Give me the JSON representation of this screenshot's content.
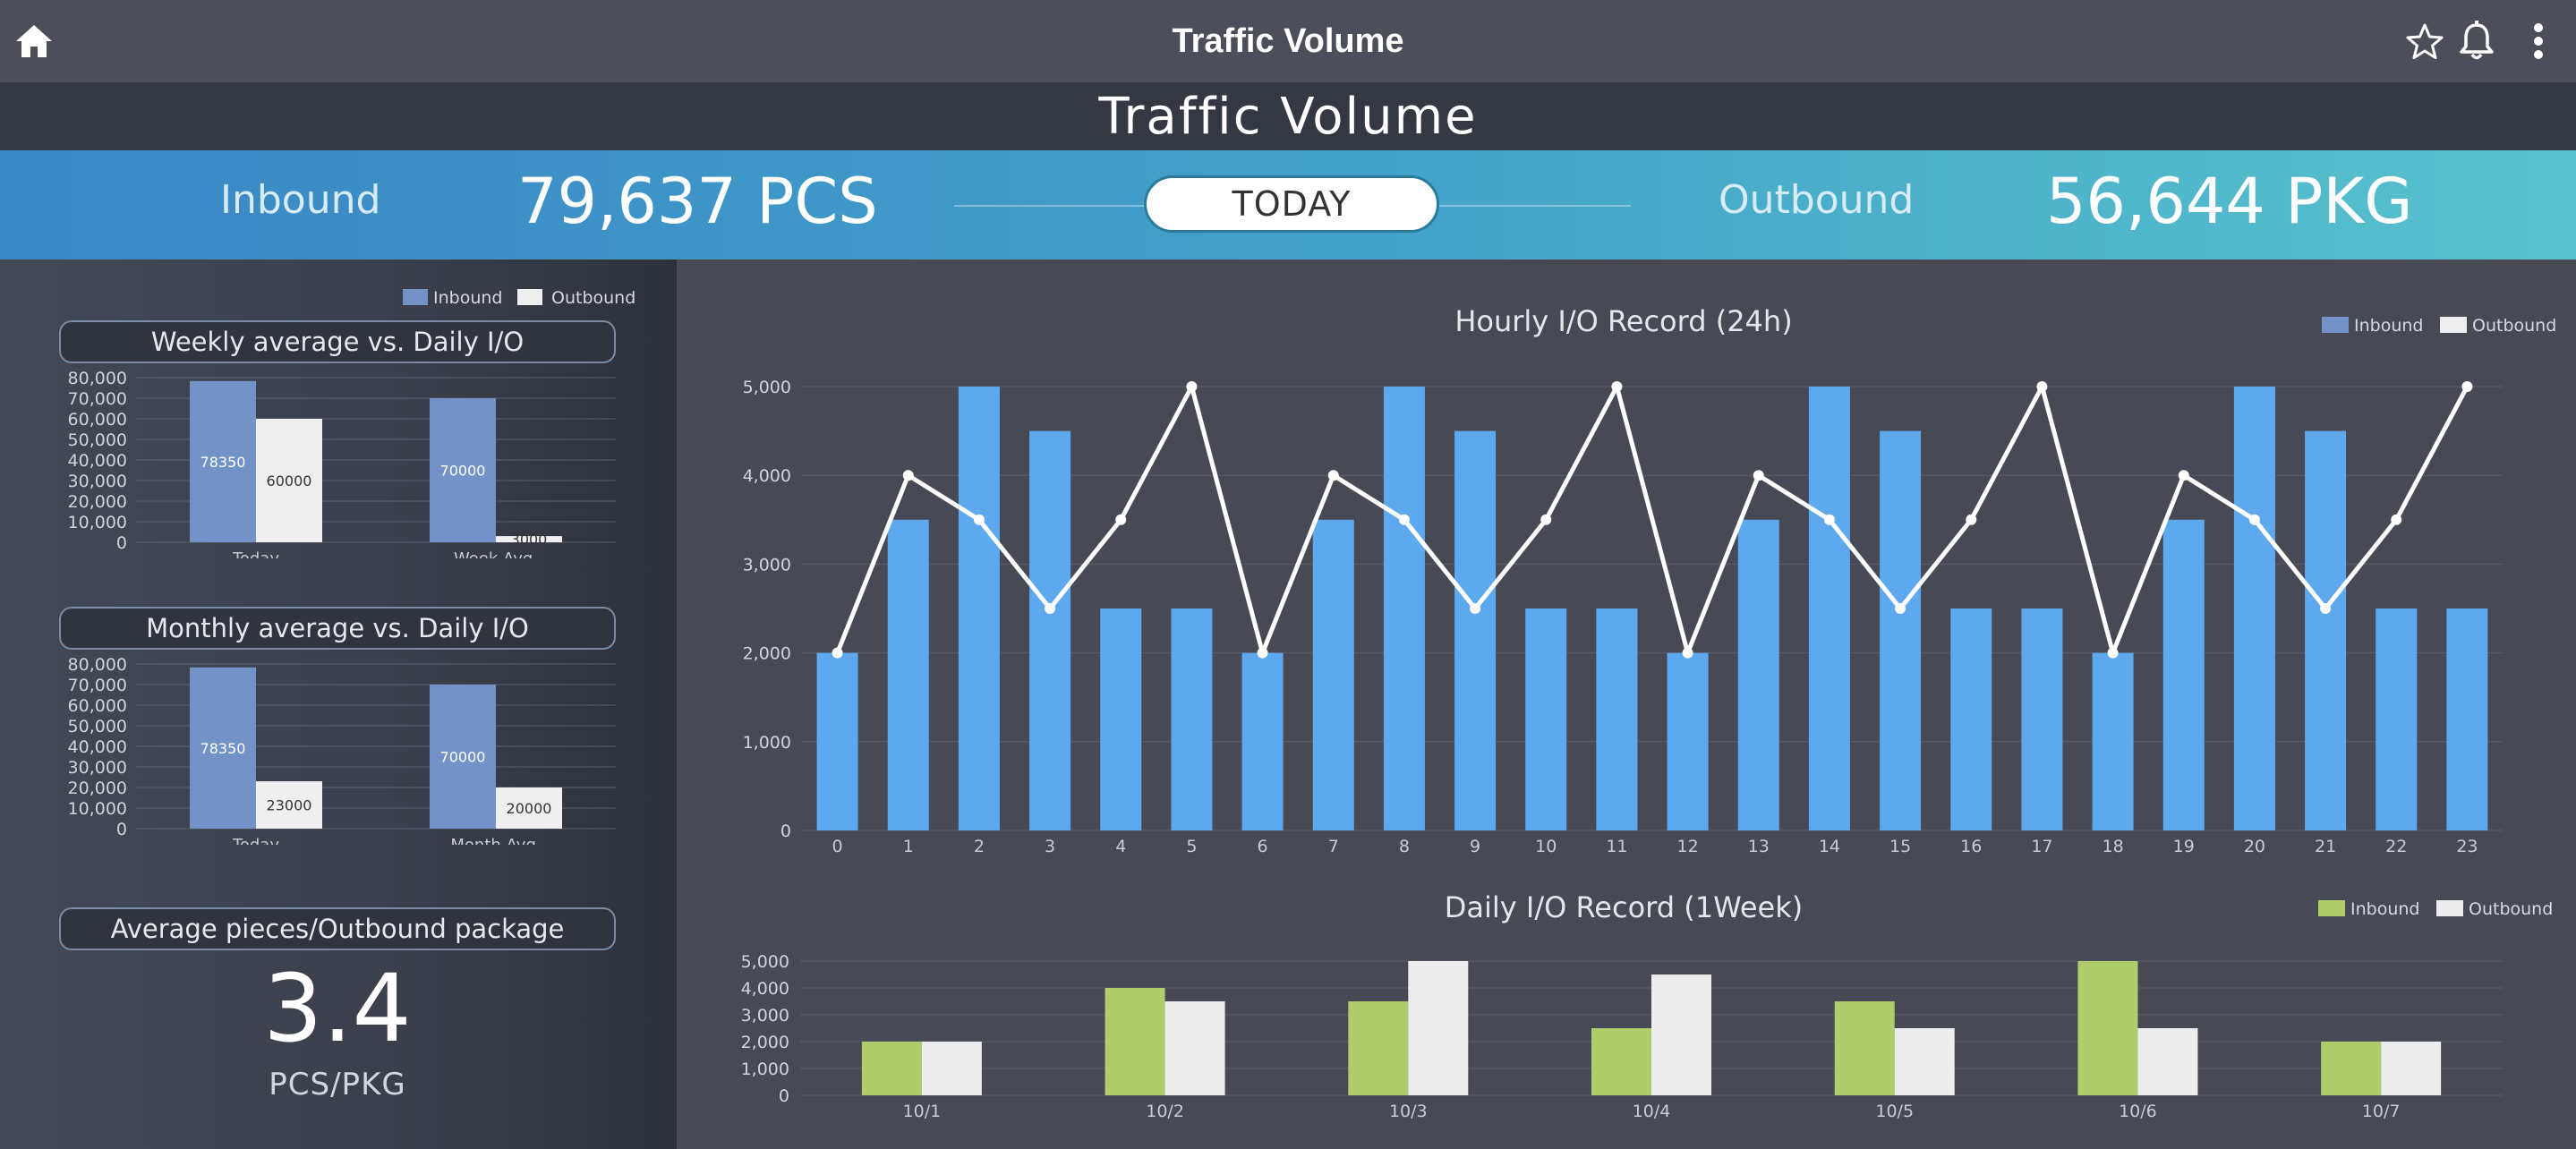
{
  "app_bar": {
    "title": "Traffic Volume",
    "icons": [
      "home-icon",
      "star-icon",
      "bell-icon",
      "more-vert-icon"
    ]
  },
  "page_title": "Traffic Volume",
  "summary": {
    "inbound_label": "Inbound",
    "inbound_value": "79,637 PCS",
    "period_button": "TODAY",
    "outbound_label": "Outbound",
    "outbound_value": "56,644 PKG"
  },
  "legend": {
    "inbound": "Inbound",
    "outbound": "Outbound"
  },
  "colors": {
    "inbound_slate": "#7393c8",
    "outbound_white": "#efefef",
    "hourly_bar": "#5ea9ee",
    "hourly_line": "#ffffff",
    "daily_inbound": "#b1cc6a",
    "daily_outbound": "#ededed",
    "banner_start": "#3a86c6",
    "banner_end": "#58c2cc"
  },
  "avg_piece": {
    "title": "Average pieces/Outbound package",
    "value": "3.4",
    "unit": "PCS/PKG"
  },
  "chart_data": [
    {
      "id": "weekly",
      "type": "bar",
      "title": "Weekly average vs. Daily I/O",
      "categories": [
        "Today",
        "Week Avg."
      ],
      "series": [
        {
          "name": "Inbound",
          "values": [
            78350,
            70000
          ]
        },
        {
          "name": "Outbound",
          "values": [
            60000,
            3000
          ]
        }
      ],
      "ylim": [
        0,
        80000
      ],
      "yticks": [
        "0",
        "10,000",
        "20,000",
        "30,000",
        "40,000",
        "50,000",
        "60,000",
        "70,000",
        "80,000"
      ],
      "data_labels": [
        [
          "78350",
          "70000"
        ],
        [
          "60000",
          "3000"
        ]
      ],
      "legend_position": "top-right"
    },
    {
      "id": "monthly",
      "type": "bar",
      "title": "Monthly average vs. Daily I/O",
      "categories": [
        "Today",
        "Month Avg."
      ],
      "series": [
        {
          "name": "Inbound",
          "values": [
            78350,
            70000
          ]
        },
        {
          "name": "Outbound",
          "values": [
            23000,
            20000
          ]
        }
      ],
      "ylim": [
        0,
        80000
      ],
      "yticks": [
        "0",
        "10,000",
        "20,000",
        "30,000",
        "40,000",
        "50,000",
        "60,000",
        "70,000",
        "80,000"
      ],
      "data_labels": [
        [
          "78350",
          "70000"
        ],
        [
          "23000",
          "20000"
        ]
      ]
    },
    {
      "id": "hourly",
      "type": "bar",
      "title": "Hourly I/O Record (24h)",
      "categories": [
        "0",
        "1",
        "2",
        "3",
        "4",
        "5",
        "6",
        "7",
        "8",
        "9",
        "10",
        "11",
        "12",
        "13",
        "14",
        "15",
        "16",
        "17",
        "18",
        "19",
        "20",
        "21",
        "22",
        "23"
      ],
      "series": [
        {
          "name": "Inbound",
          "type": "bar",
          "values": [
            2000,
            3500,
            5000,
            4500,
            2500,
            2500,
            2000,
            3500,
            5000,
            4500,
            2500,
            2500,
            2000,
            3500,
            5000,
            4500,
            2500,
            2500,
            2000,
            3500,
            5000,
            4500,
            2500,
            2500
          ]
        },
        {
          "name": "Outbound",
          "type": "line",
          "values": [
            2000,
            4000,
            3500,
            2500,
            3500,
            5000,
            2000,
            4000,
            3500,
            2500,
            3500,
            5000,
            2000,
            4000,
            3500,
            2500,
            3500,
            5000,
            2000,
            4000,
            3500,
            2500,
            3500,
            5000
          ]
        }
      ],
      "ylim": [
        0,
        5000
      ],
      "yticks": [
        "0",
        "1,000",
        "2,000",
        "3,000",
        "4,000",
        "5,000"
      ],
      "legend_position": "top-right",
      "grid": true
    },
    {
      "id": "daily",
      "type": "bar",
      "title": "Daily I/O Record (1Week)",
      "categories": [
        "10/1",
        "10/2",
        "10/3",
        "10/4",
        "10/5",
        "10/6",
        "10/7"
      ],
      "series": [
        {
          "name": "Inbound",
          "values": [
            2000,
            4000,
            3500,
            2500,
            3500,
            5000,
            2000
          ]
        },
        {
          "name": "Outbound",
          "values": [
            2000,
            3500,
            5000,
            4500,
            2500,
            2500,
            2000
          ]
        }
      ],
      "ylim": [
        0,
        5000
      ],
      "yticks": [
        "0",
        "1,000",
        "2,000",
        "3,000",
        "4,000",
        "5,000"
      ],
      "legend_position": "top-right",
      "grid": true
    }
  ]
}
